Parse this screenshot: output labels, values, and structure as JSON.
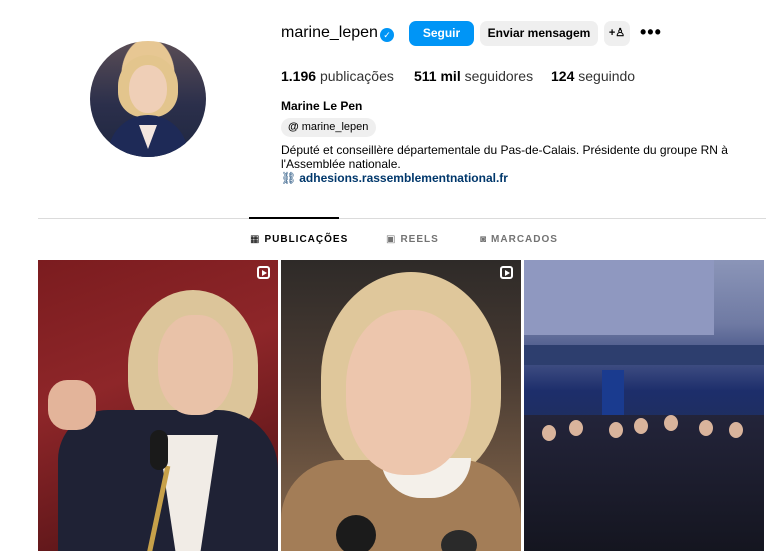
{
  "profile": {
    "username": "marine_lepen",
    "verified_icon": "verified-badge-icon",
    "follow_label": "Seguir",
    "message_label": "Enviar mensagem",
    "suggest_icon": "person-add-icon",
    "more_icon": "more-options-icon",
    "more_glyph": "•••",
    "stats": [
      {
        "value": "1.196",
        "label": "publicações"
      },
      {
        "value": "511 mil",
        "label": "seguidores"
      },
      {
        "value": "124",
        "label": "seguindo"
      }
    ],
    "full_name": "Marine Le Pen",
    "threads_handle": "marine_lepen",
    "bio": "Député et conseillère départementale du Pas-de-Calais. Présidente du groupe RN à l'Assemblée nationale.",
    "link": "adhesions.rassemblementnational.fr"
  },
  "tabs": [
    {
      "label": "PUBLICAÇÕES",
      "icon": "grid-icon",
      "active": true
    },
    {
      "label": "REELS",
      "icon": "reels-icon",
      "active": false
    },
    {
      "label": "MARCADOS",
      "icon": "tagged-icon",
      "active": false
    }
  ],
  "colors": {
    "accent": "#0095f6",
    "link": "#00376b",
    "button_secondary": "#efefef"
  }
}
